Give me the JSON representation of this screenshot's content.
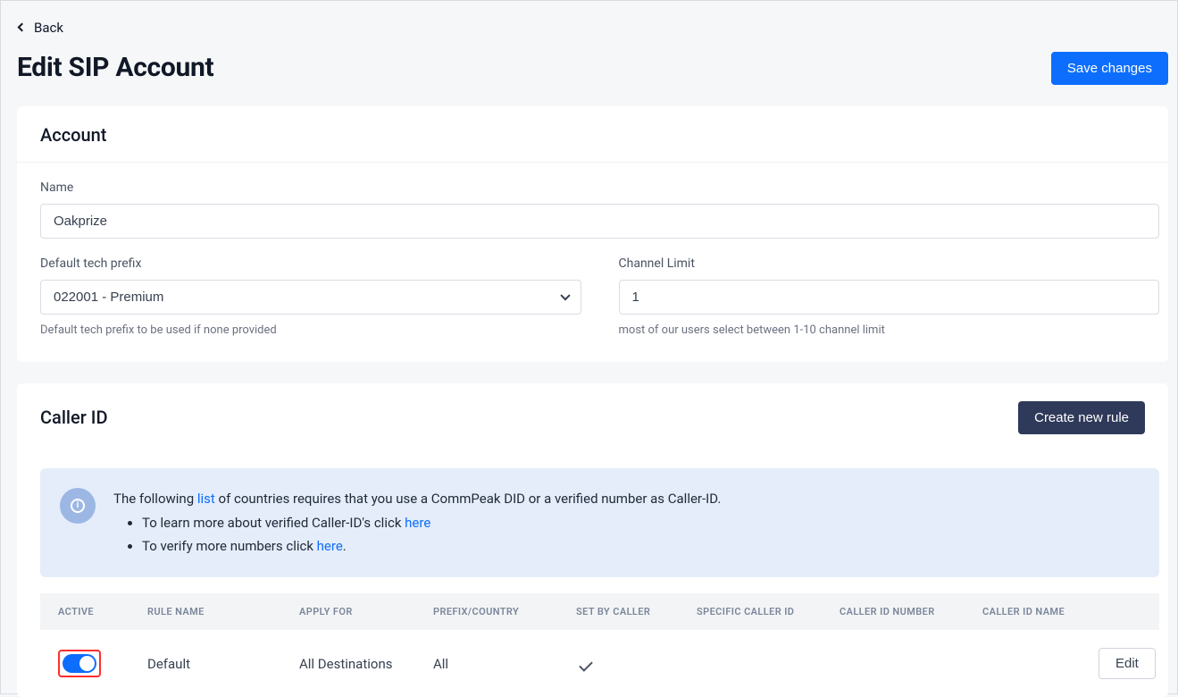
{
  "back_label": "Back",
  "page_title": "Edit SIP Account",
  "save_label": "Save changes",
  "account": {
    "section_title": "Account",
    "name_label": "Name",
    "name_value": "Oakprize",
    "prefix_label": "Default tech prefix",
    "prefix_value": "022001 - Premium",
    "prefix_help": "Default tech prefix to be used if none provided",
    "channel_label": "Channel Limit",
    "channel_value": "1",
    "channel_help": "most of our users select between 1-10 channel limit"
  },
  "caller_id": {
    "section_title": "Caller ID",
    "create_button": "Create new rule",
    "info": {
      "line1_pre": "The following ",
      "line1_link": "list",
      "line1_post": " of countries requires that you use a CommPeak DID or a verified number as Caller-ID.",
      "bullet1_pre": "To learn more about verified Caller-ID's click ",
      "bullet1_link": "here",
      "bullet2_pre": "To verify more numbers click ",
      "bullet2_link": "here",
      "bullet2_post": "."
    },
    "columns": {
      "active": "ACTIVE",
      "rule_name": "RULE NAME",
      "apply_for": "APPLY FOR",
      "prefix_country": "PREFIX/COUNTRY",
      "set_by_caller": "SET BY CALLER",
      "specific_caller_id": "SPECIFIC CALLER ID",
      "caller_id_number": "CALLER ID NUMBER",
      "caller_id_name": "CALLER ID NAME"
    },
    "rows": [
      {
        "active": true,
        "rule_name": "Default",
        "apply_for": "All Destinations",
        "prefix_country": "All",
        "set_by_caller": true,
        "specific_caller_id": "",
        "caller_id_number": "",
        "caller_id_name": ""
      }
    ],
    "edit_label": "Edit"
  }
}
